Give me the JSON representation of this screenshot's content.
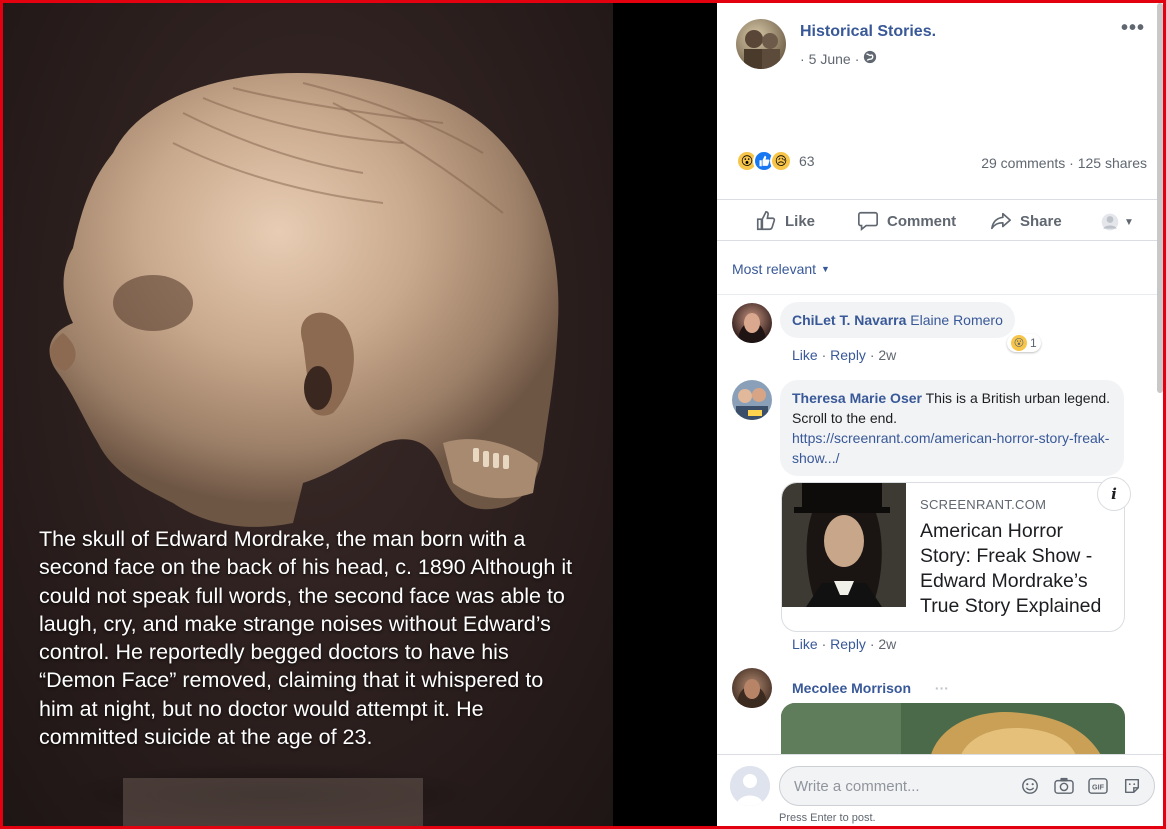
{
  "photo": {
    "caption": "The skull of Edward Mordrake, the man born with a second face on the back of his head, c. 1890 Although it could not speak full words, the second face was able to laugh, cry, and make strange noises without Edward’s control. He reportedly begged doctors to have his “Demon Face” removed, claiming that it whispered to him at night, but no doctor would attempt it. He committed suicide at the age of 23."
  },
  "post": {
    "page_name": "Historical Stories.",
    "date": "5 June",
    "reaction_count": "63",
    "comments": "29 comments",
    "shares": "125 shares",
    "more_icon": "more-dots-icon"
  },
  "actions": {
    "like": "Like",
    "comment": "Comment",
    "share": "Share"
  },
  "filter": {
    "label": "Most relevant"
  },
  "comments": [
    {
      "author": "ChiLet T. Navarra",
      "text": "Elaine Romero",
      "like": "Like",
      "reply": "Reply",
      "time": "2w",
      "reaction_count": "1"
    },
    {
      "author": "Theresa Marie Oser",
      "text": "This is a British urban legend. Scroll to the end.",
      "link": "https://screenrant.com/american-horror-story-freak-show.../",
      "like": "Like",
      "reply": "Reply",
      "time": "2w",
      "card": {
        "domain": "SCREENRANT.COM",
        "title": "American Horror Story: Freak Show - Edward Mordrake’s True Story Explained"
      }
    },
    {
      "author": "Mecolee Morrison",
      "more": "···"
    }
  ],
  "composer": {
    "placeholder": "Write a comment...",
    "hint": "Press Enter to post."
  },
  "colors": {
    "link": "#385898",
    "frame": "#e3000f",
    "bubble": "#f2f3f5"
  }
}
